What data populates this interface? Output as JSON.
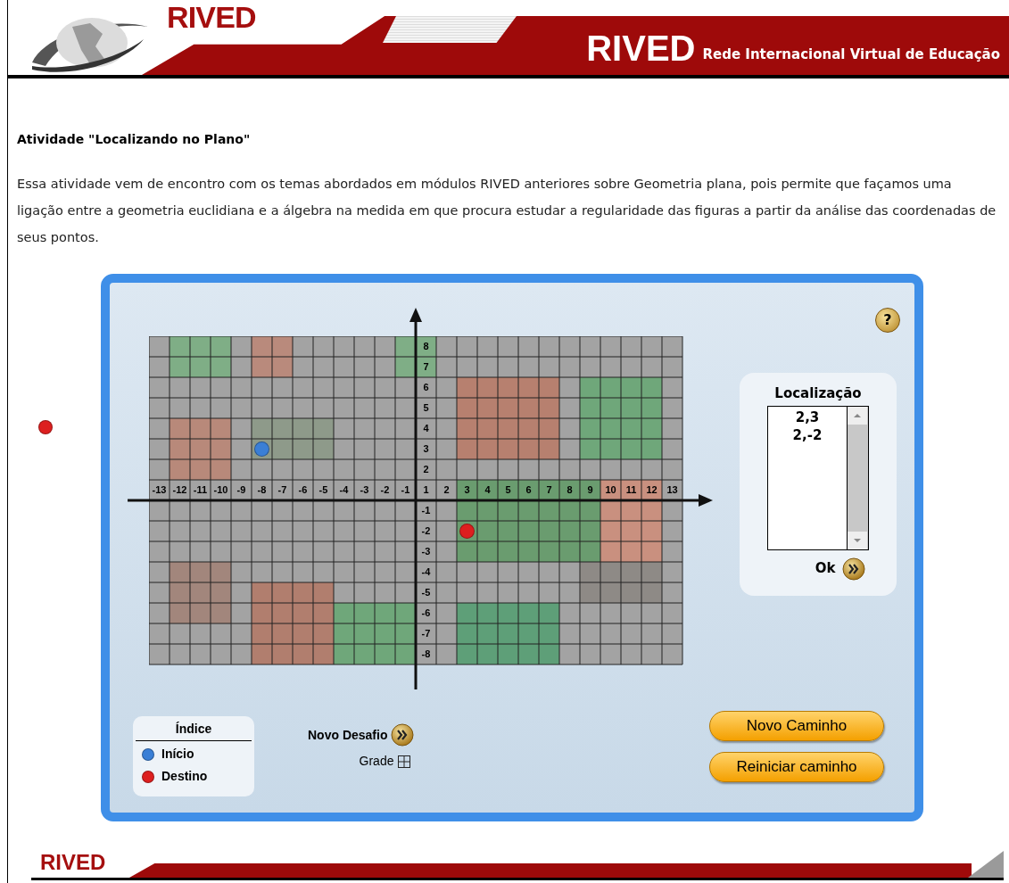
{
  "header": {
    "logo_text": "RIVED",
    "brand": "RIVED",
    "tagline": "Rede Internacional Virtual de Educação"
  },
  "title": "Atividade \"Localizando no Plano\"",
  "intro": "Essa atividade vem de encontro com os temas abordados em módulos RIVED anteriores sobre Geometria plana, pois permite que façamos uma ligação entre a geometria euclidiana e a álgebra na medida em que procura estudar a regularidade das figuras a partir da análise das coordenadas de seus pontos.",
  "activity": {
    "help_button": "?",
    "grid": {
      "x_labels": [
        "-13",
        "-12",
        "-11",
        "-10",
        "-9",
        "-8",
        "-7",
        "-6",
        "-5",
        "-4",
        "-3",
        "-2",
        "-1",
        "1",
        "2",
        "3",
        "4",
        "5",
        "6",
        "7",
        "8",
        "9",
        "10",
        "11",
        "12",
        "13"
      ],
      "y_labels": [
        "8",
        "7",
        "6",
        "5",
        "4",
        "3",
        "2",
        "-1",
        "-2",
        "-3",
        "-4",
        "-5",
        "-6",
        "-7",
        "-8"
      ]
    },
    "location": {
      "label": "Localização",
      "value": "2,3\n2,-2",
      "ok_button": "Ok"
    },
    "legend": {
      "title": "Índice",
      "items": [
        {
          "label": "Início",
          "color": "#3a7fd6"
        },
        {
          "label": "Destino",
          "color": "#dd1f1f"
        }
      ]
    },
    "new_challenge": "Novo Desafio",
    "grid_toggle": "Grade",
    "buttons": [
      "Novo Caminho",
      "Reiniciar caminho"
    ]
  },
  "footer": {
    "logo_text": "RIVED"
  }
}
